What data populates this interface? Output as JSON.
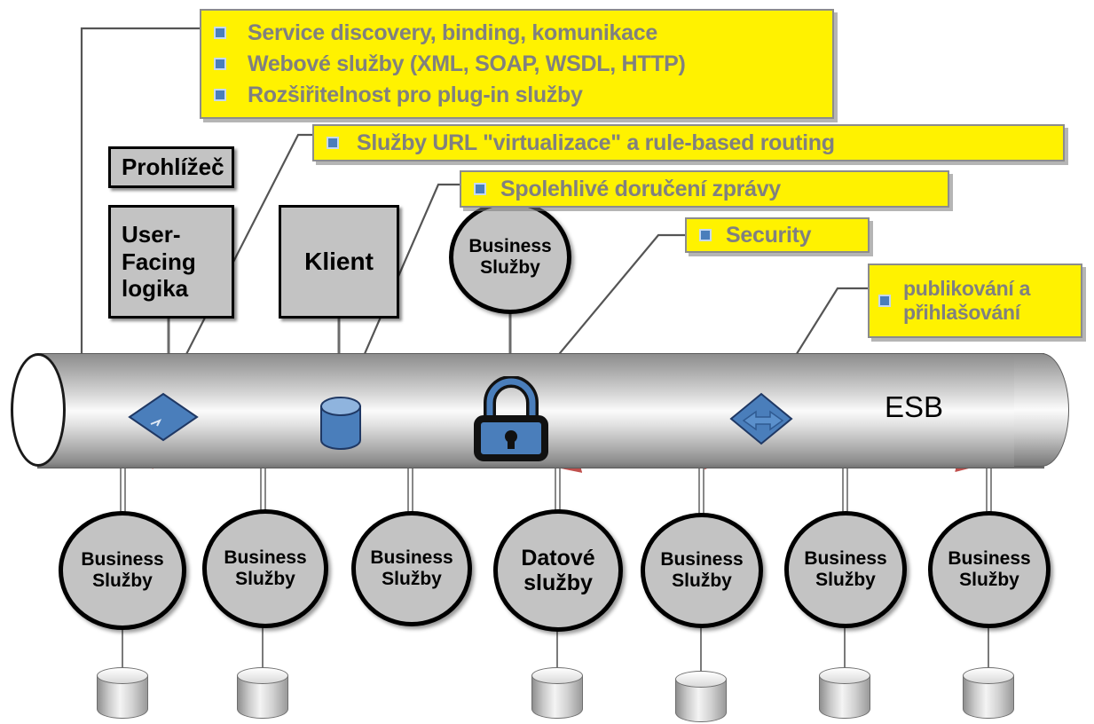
{
  "diagram": {
    "title": "ESB architecture diagram",
    "esb_label": "ESB",
    "colors": {
      "callout_fill": "#FFF200",
      "callout_border": "#8C8C8C",
      "callout_text": "#808080",
      "bullet": "#4A7EBB",
      "node_fill": "#C3C3C3",
      "node_border": "#000000",
      "arrow_red": "#C0504D",
      "icon_blue": "#4A7EBB"
    }
  },
  "callouts": [
    {
      "id": "callout-capabilities",
      "lines": [
        "Service discovery, binding, komunikace",
        "Webové služby (XML, SOAP, WSDL, HTTP)",
        "Rozšiřitelnost pro plug-in služby"
      ]
    },
    {
      "id": "callout-routing",
      "lines": [
        "Služby URL \"virtualizace\" a rule-based routing"
      ]
    },
    {
      "id": "callout-delivery",
      "lines": [
        "Spolehlivé doručení zprávy"
      ]
    },
    {
      "id": "callout-security",
      "lines": [
        "Security"
      ]
    },
    {
      "id": "callout-publish",
      "lines": [
        "publikování a",
        "přihlašování"
      ]
    }
  ],
  "top_nodes": [
    {
      "id": "node-browser",
      "label": "Prohlížeč",
      "shape": "rect"
    },
    {
      "id": "node-uflogic",
      "label": "User-\nFacing\nlogika",
      "shape": "rect"
    },
    {
      "id": "node-client",
      "label": "Klient",
      "shape": "rect"
    },
    {
      "id": "node-bizsvc-top",
      "label": "Business\nSlužby",
      "shape": "circle"
    }
  ],
  "bottom_nodes": [
    {
      "id": "service-1",
      "label": "Business\nSlužby",
      "has_database": true
    },
    {
      "id": "service-2",
      "label": "Business\nSlužby",
      "has_database": true
    },
    {
      "id": "service-3",
      "label": "Business\nSlužby",
      "has_database": false
    },
    {
      "id": "service-4",
      "label": "Datové\nslužby",
      "has_database": true
    },
    {
      "id": "service-5",
      "label": "Business\nSlužby",
      "has_database": true
    },
    {
      "id": "service-6",
      "label": "Business\nSlužby",
      "has_database": true
    },
    {
      "id": "service-7",
      "label": "Business\nSlužby",
      "has_database": true
    }
  ],
  "bus_icons": [
    {
      "id": "icon-router-left",
      "type": "diamond-router"
    },
    {
      "id": "icon-message-store",
      "type": "database-cylinder"
    },
    {
      "id": "icon-security-lock",
      "type": "padlock"
    },
    {
      "id": "icon-router-right",
      "type": "diamond-router"
    }
  ]
}
